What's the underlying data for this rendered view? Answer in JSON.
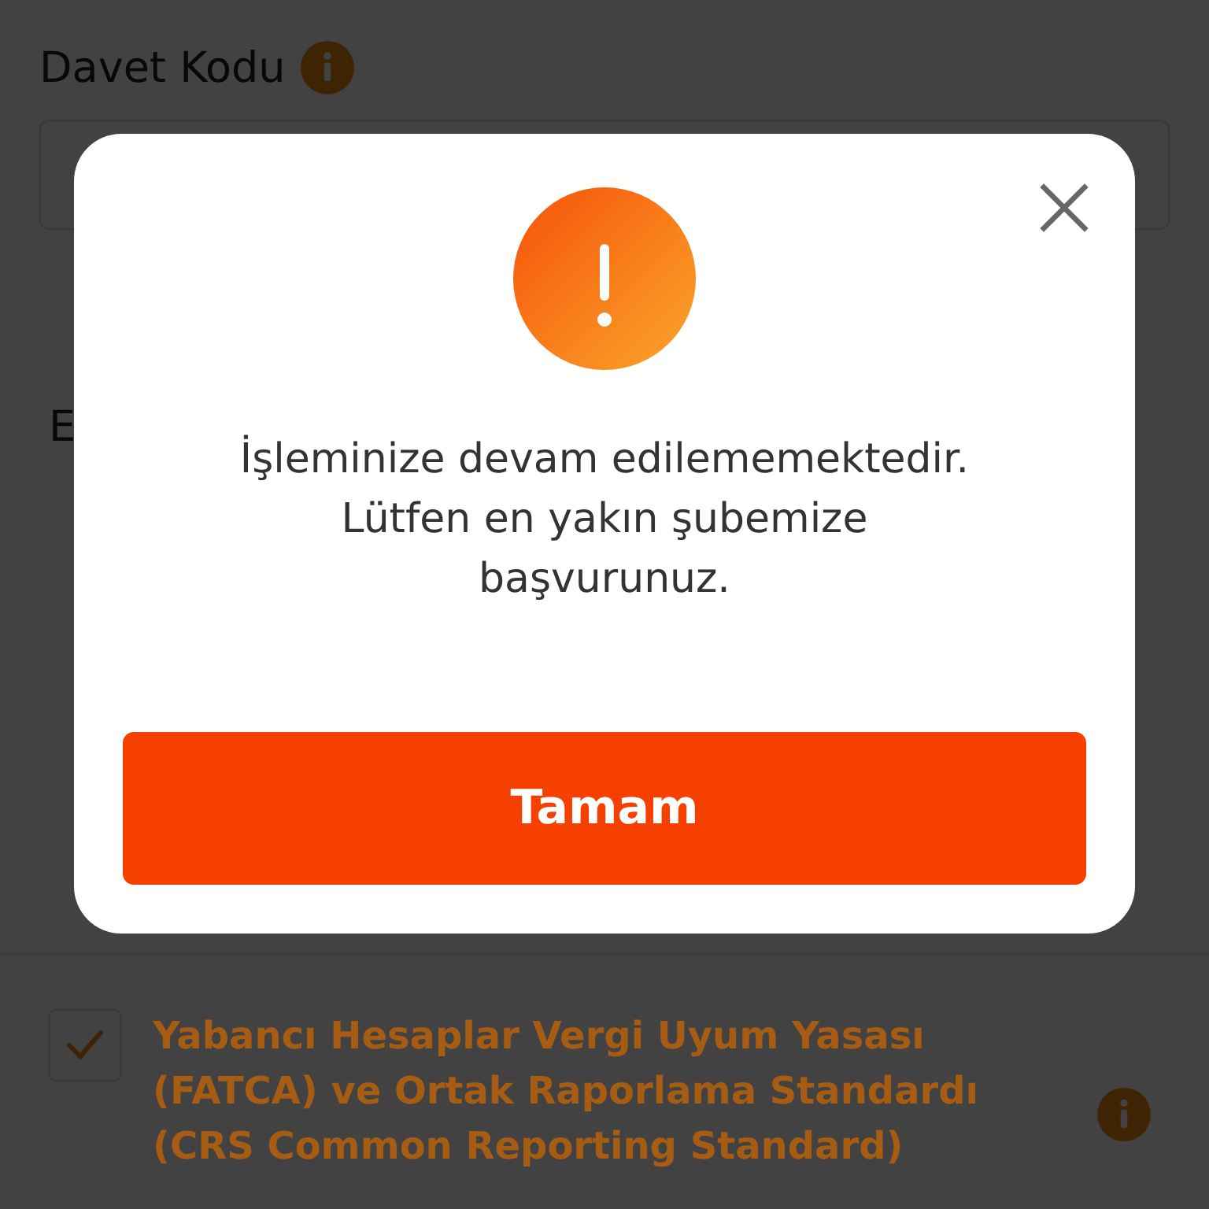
{
  "form": {
    "invite_label": "Davet Kodu",
    "section_title_fragment": "E",
    "consent": {
      "checked": true,
      "text": "Yabancı Hesaplar Vergi Uyum Yasası (FATCA) ve Ortak Raporlama Standardı (CRS Common Reporting Standard)"
    }
  },
  "dialog": {
    "message": "İşleminize devam edilememektedir. Lütfen en yakın şubemize başvurunuz.",
    "button": "Tamam"
  }
}
